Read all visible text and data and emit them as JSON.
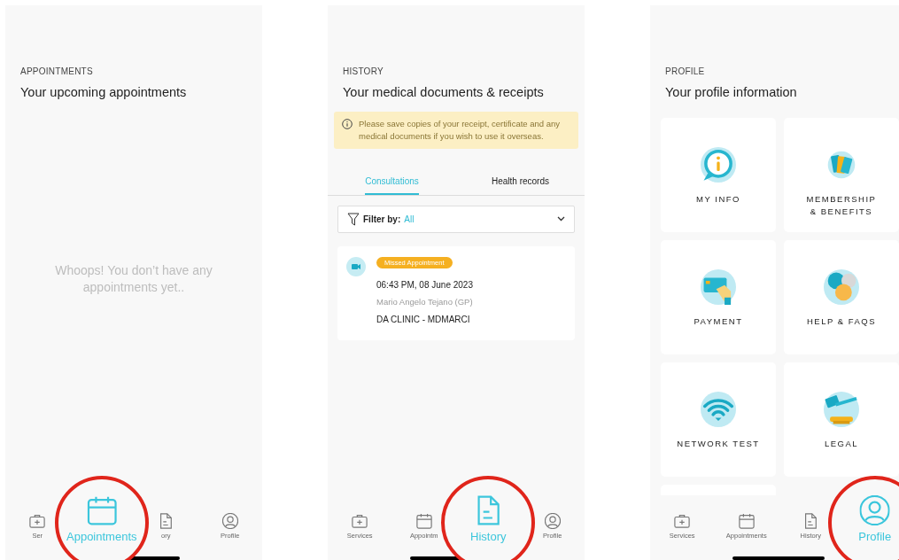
{
  "screens": [
    {
      "kind": "appointments",
      "section": "APPOINTMENTS",
      "title": "Your upcoming appointments",
      "empty_message": "Whoops! You don’t have any appointments yet..",
      "tab_bar": [
        {
          "label": "Ser",
          "selected": false
        },
        {
          "label": "Appointments",
          "selected": true
        },
        {
          "label": "ory",
          "selected": false
        },
        {
          "label": "Profile",
          "selected": false
        }
      ]
    },
    {
      "kind": "history",
      "section": "HISTORY",
      "title": "Your medical documents & receipts",
      "notice": "Please save copies of your receipt, certificate and any medical documents if you wish to use it overseas.",
      "tabs": [
        {
          "label": "Consultations",
          "selected": true
        },
        {
          "label": "Health records",
          "selected": false
        }
      ],
      "filter": {
        "label": "Filter by:",
        "value": "All"
      },
      "records": [
        {
          "badge": "Missed Appointment",
          "datetime": "06:43 PM, 08 June 2023",
          "doctor": "Mario Angelo Tejano (GP)",
          "clinic": "DA CLINIC - MDMARCI"
        }
      ],
      "tab_bar": [
        {
          "label": "Services",
          "selected": false
        },
        {
          "label": "Appointm",
          "selected": false
        },
        {
          "label": "History",
          "selected": true
        },
        {
          "label": "Profile",
          "selected": false
        }
      ]
    },
    {
      "kind": "profile",
      "section": "PROFILE",
      "title": "Your profile information",
      "tiles": [
        {
          "label": "MY INFO"
        },
        {
          "label": "MEMBERSHIP\n& BENEFITS"
        },
        {
          "label": "PAYMENT"
        },
        {
          "label": "HELP & FAQS"
        },
        {
          "label": "NETWORK TEST"
        },
        {
          "label": "LEGAL"
        }
      ],
      "tab_bar": [
        {
          "label": "Services",
          "selected": false
        },
        {
          "label": "Appointments",
          "selected": false
        },
        {
          "label": "History",
          "selected": false
        },
        {
          "label": "Profile",
          "selected": true
        }
      ]
    }
  ]
}
